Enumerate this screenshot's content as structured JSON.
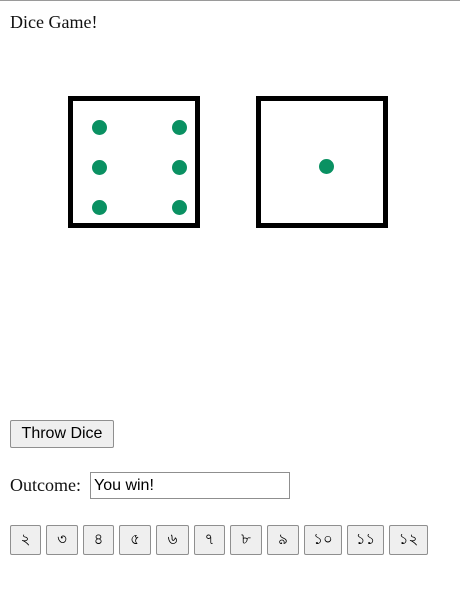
{
  "page": {
    "title": "Dice Game!"
  },
  "dice": [
    {
      "value": 6,
      "pip_color": "#0a9162"
    },
    {
      "value": 1,
      "pip_color": "#0a9162"
    }
  ],
  "controls": {
    "throw_label": "Throw Dice"
  },
  "outcome": {
    "label": "Outcome:",
    "value": "You win!"
  },
  "bets": [
    "২",
    "৩",
    "৪",
    "৫",
    "৬",
    "৭",
    "৮",
    "৯",
    "১০",
    "১১",
    "১২"
  ]
}
